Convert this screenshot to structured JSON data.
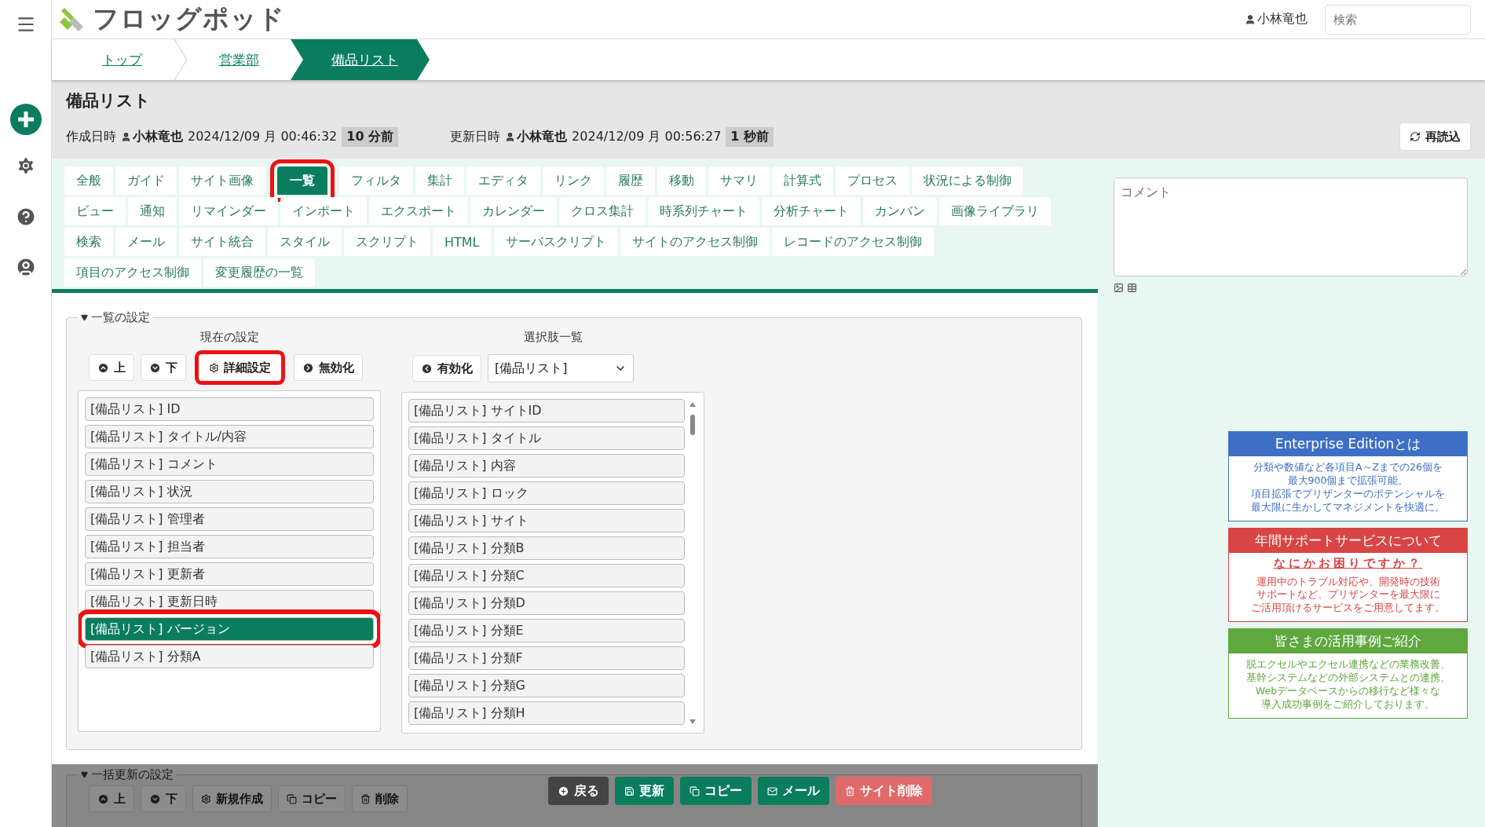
{
  "logo": {
    "text": "フロッグポッド"
  },
  "header": {
    "user": "小林竜也",
    "search": {
      "placeholder": "検索"
    }
  },
  "breadcrumb": [
    {
      "label": "トップ",
      "selected": false
    },
    {
      "label": "営業部",
      "selected": false
    },
    {
      "label": "備品リスト",
      "selected": true
    }
  ],
  "page": {
    "title": "備品リスト",
    "reload_button": "再読込",
    "meta": [
      {
        "label": "作成日時",
        "user": "小林竜也",
        "datetime": "2024/12/09 月 00:46:32",
        "ago": "10 分前"
      },
      {
        "label": "更新日時",
        "user": "小林竜也",
        "datetime": "2024/12/09 月 00:56:27",
        "ago": "1 秒前"
      }
    ]
  },
  "tab_rows": [
    [
      {
        "label": "全般",
        "selected": false,
        "highlighted": false
      },
      {
        "label": "ガイド",
        "selected": false,
        "highlighted": false
      },
      {
        "label": "サイト画像",
        "selected": false,
        "highlighted": false
      },
      {
        "label": "一覧",
        "selected": true,
        "highlighted": true
      },
      {
        "label": "フィルタ",
        "selected": false,
        "highlighted": false
      },
      {
        "label": "集計",
        "selected": false,
        "highlighted": false
      },
      {
        "label": "エディタ",
        "selected": false,
        "highlighted": false
      },
      {
        "label": "リンク",
        "selected": false,
        "highlighted": false
      },
      {
        "label": "履歴",
        "selected": false,
        "highlighted": false
      },
      {
        "label": "移動",
        "selected": false,
        "highlighted": false
      },
      {
        "label": "サマリ",
        "selected": false,
        "highlighted": false
      },
      {
        "label": "計算式",
        "selected": false,
        "highlighted": false
      },
      {
        "label": "プロセス",
        "selected": false,
        "highlighted": false
      },
      {
        "label": "状況による制御",
        "selected": false,
        "highlighted": false
      }
    ],
    [
      {
        "label": "ビュー",
        "selected": false,
        "highlighted": false
      },
      {
        "label": "通知",
        "selected": false,
        "highlighted": false
      },
      {
        "label": "リマインダー",
        "selected": false,
        "highlighted": false
      },
      {
        "label": "インポート",
        "selected": false,
        "highlighted": false
      },
      {
        "label": "エクスポート",
        "selected": false,
        "highlighted": false
      },
      {
        "label": "カレンダー",
        "selected": false,
        "highlighted": false
      },
      {
        "label": "クロス集計",
        "selected": false,
        "highlighted": false
      },
      {
        "label": "時系列チャート",
        "selected": false,
        "highlighted": false
      },
      {
        "label": "分析チャート",
        "selected": false,
        "highlighted": false
      },
      {
        "label": "カンバン",
        "selected": false,
        "highlighted": false
      },
      {
        "label": "画像ライブラリ",
        "selected": false,
        "highlighted": false
      }
    ],
    [
      {
        "label": "検索",
        "selected": false,
        "highlighted": false
      },
      {
        "label": "メール",
        "selected": false,
        "highlighted": false
      },
      {
        "label": "サイト統合",
        "selected": false,
        "highlighted": false
      },
      {
        "label": "スタイル",
        "selected": false,
        "highlighted": false
      },
      {
        "label": "スクリプト",
        "selected": false,
        "highlighted": false
      },
      {
        "label": "HTML",
        "selected": false,
        "highlighted": false
      },
      {
        "label": "サーバスクリプト",
        "selected": false,
        "highlighted": false
      },
      {
        "label": "サイトのアクセス制御",
        "selected": false,
        "highlighted": false
      },
      {
        "label": "レコードのアクセス制御",
        "selected": false,
        "highlighted": false
      }
    ],
    [
      {
        "label": "項目のアクセス制御",
        "selected": false,
        "highlighted": false
      },
      {
        "label": "変更履歴の一覧",
        "selected": false,
        "highlighted": false
      }
    ]
  ],
  "comment": {
    "placeholder": "コメント"
  },
  "list_settings": {
    "legend": "一覧の設定",
    "expanded": true,
    "current": {
      "heading": "現在の設定",
      "buttons": [
        {
          "label": "上",
          "kind": "up",
          "highlighted": false
        },
        {
          "label": "下",
          "kind": "down",
          "highlighted": false
        },
        {
          "label": "詳細設定",
          "kind": "gear",
          "highlighted": true
        },
        {
          "label": "無効化",
          "kind": "right",
          "highlighted": false
        }
      ],
      "items": [
        {
          "label": "[備品リスト] ID",
          "selected": false,
          "highlighted": false
        },
        {
          "label": "[備品リスト] タイトル/内容",
          "selected": false,
          "highlighted": false
        },
        {
          "label": "[備品リスト] コメント",
          "selected": false,
          "highlighted": false
        },
        {
          "label": "[備品リスト] 状況",
          "selected": false,
          "highlighted": false
        },
        {
          "label": "[備品リスト] 管理者",
          "selected": false,
          "highlighted": false
        },
        {
          "label": "[備品リスト] 担当者",
          "selected": false,
          "highlighted": false
        },
        {
          "label": "[備品リスト] 更新者",
          "selected": false,
          "highlighted": false
        },
        {
          "label": "[備品リスト] 更新日時",
          "selected": false,
          "highlighted": false
        },
        {
          "label": "[備品リスト] バージョン",
          "selected": true,
          "highlighted": true
        },
        {
          "label": "[備品リスト] 分類A",
          "selected": false,
          "highlighted": false
        }
      ]
    },
    "options": {
      "heading": "選択肢一覧",
      "button": {
        "label": "有効化",
        "kind": "left"
      },
      "select": "[備品リスト]",
      "items": [
        {
          "label": "[備品リスト] サイトID",
          "selected": false
        },
        {
          "label": "[備品リスト] タイトル",
          "selected": false
        },
        {
          "label": "[備品リスト] 内容",
          "selected": false
        },
        {
          "label": "[備品リスト] ロック",
          "selected": false
        },
        {
          "label": "[備品リスト] サイト",
          "selected": false
        },
        {
          "label": "[備品リスト] 分類B",
          "selected": false
        },
        {
          "label": "[備品リスト] 分類C",
          "selected": false
        },
        {
          "label": "[備品リスト] 分類D",
          "selected": false
        },
        {
          "label": "[備品リスト] 分類E",
          "selected": false
        },
        {
          "label": "[備品リスト] 分類F",
          "selected": false
        },
        {
          "label": "[備品リスト] 分類G",
          "selected": false
        },
        {
          "label": "[備品リスト] 分類H",
          "selected": false
        }
      ]
    }
  },
  "bulk_settings": {
    "legend": "一括更新の設定",
    "expanded": true,
    "buttons": [
      {
        "label": "上",
        "kind": "up"
      },
      {
        "label": "下",
        "kind": "down"
      },
      {
        "label": "新規作成",
        "kind": "gear"
      },
      {
        "label": "コピー",
        "kind": "copy"
      },
      {
        "label": "削除",
        "kind": "trash"
      }
    ]
  },
  "footer_buttons": [
    {
      "label": "戻る",
      "kind": "back"
    },
    {
      "label": "更新",
      "kind": "save"
    },
    {
      "label": "コピー",
      "kind": "copy"
    },
    {
      "label": "メール",
      "kind": "mail"
    },
    {
      "label": "サイト削除",
      "kind": "delete"
    }
  ],
  "ads": [
    {
      "title": "Enterprise Editionとは",
      "color": "#3d6fc4",
      "lines": [
        "分類や数値など各項目A～Zまでの26個を",
        "最大900個まで拡張可能。",
        "項目拡張でプリザンターのポテンシャルを",
        "最大限に生かしてマネジメントを快適に。"
      ]
    },
    {
      "title": "年間サポートサービスについて",
      "color": "#d94545",
      "subtitle": "なにかお困りですか？",
      "lines": [
        "運用中のトラブル対応や、開発時の技術",
        "サポートなど、プリザンターを最大限に",
        "ご活用頂けるサービスをご用意してます。"
      ]
    },
    {
      "title": "皆さまの活用事例ご紹介",
      "color": "#5ea83f",
      "lines": [
        "脱エクセルやエクセル連携などの業務改善、",
        "基幹システムなどの外部システムとの連携、",
        "Webデータベースからの移行など様々な",
        "導入成功事例をご紹介しております。"
      ]
    }
  ]
}
